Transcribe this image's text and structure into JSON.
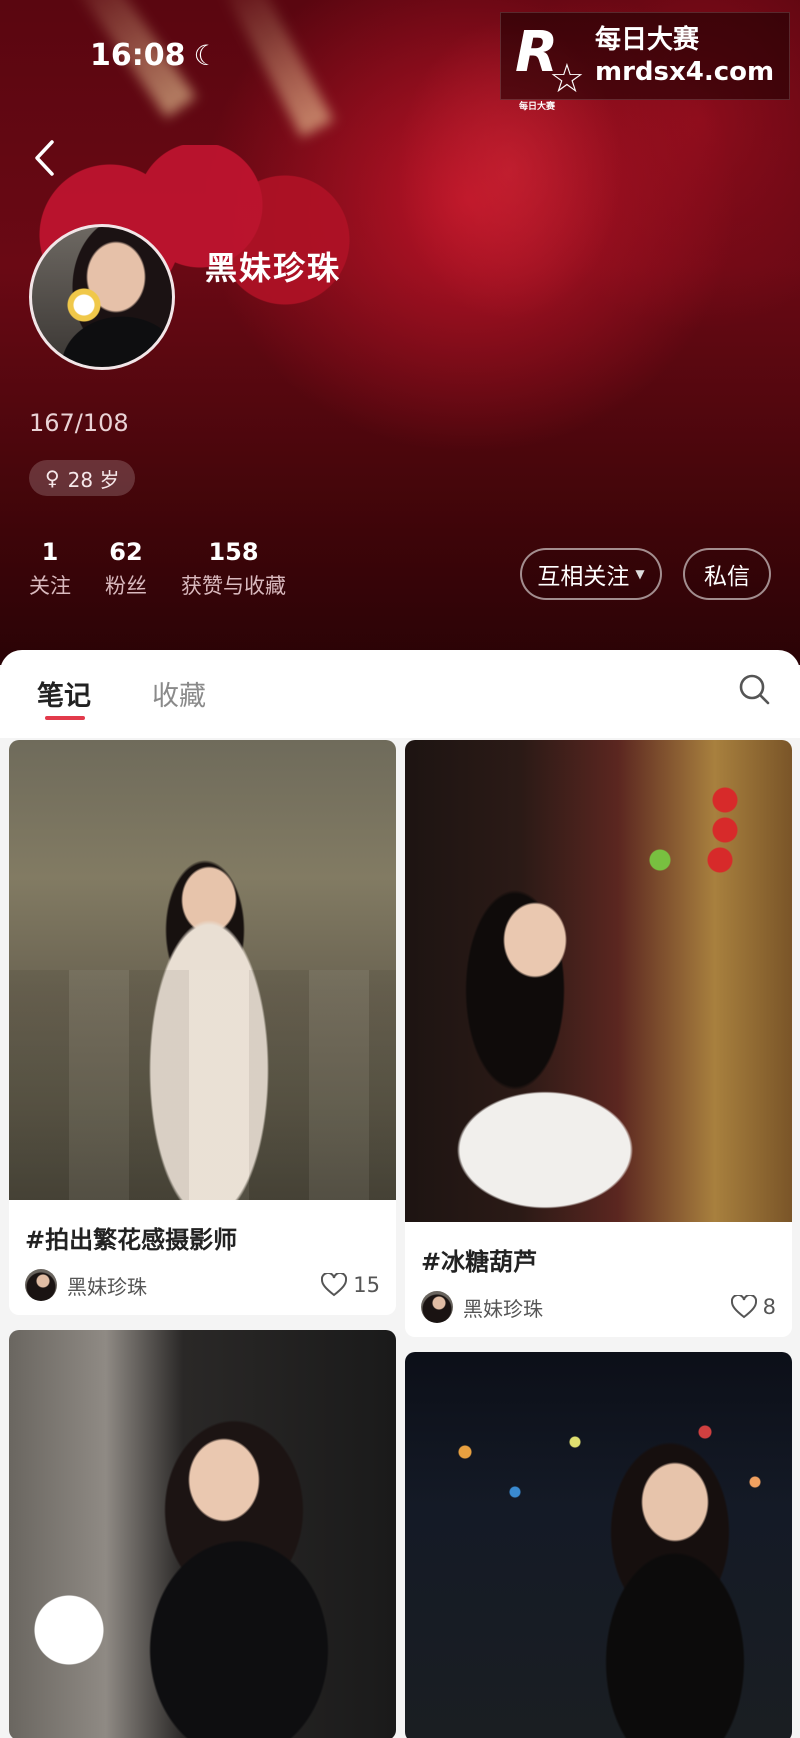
{
  "status_bar": {
    "time": "16:08",
    "moon_icon": "moon-icon"
  },
  "watermark": {
    "logo_letter": "R",
    "logo_small": "每日大赛",
    "line1": "每日大赛",
    "line2": "mrdsx4.com"
  },
  "profile": {
    "name": "黑妹珍珠",
    "height_weight": "167/108",
    "age": "28 岁",
    "gender_icon": "female-icon",
    "stats": [
      {
        "value": "1",
        "label": "关注"
      },
      {
        "value": "62",
        "label": "粉丝"
      },
      {
        "value": "158",
        "label": "获赞与收藏"
      }
    ],
    "follow_button": "互相关注",
    "message_button": "私信"
  },
  "tabs": {
    "notes": "笔记",
    "favorites": "收藏",
    "active": "笔记"
  },
  "colors": {
    "accent": "#e23a4b",
    "header_bg": "#5a0610"
  },
  "posts": [
    {
      "title": "#拍出繁花感摄影师",
      "author": "黑妹珍珠",
      "likes": "15"
    },
    {
      "title": "#冰糖葫芦",
      "author": "黑妹珍珠",
      "likes": "8"
    },
    {
      "title": "",
      "author": "",
      "likes": ""
    },
    {
      "title": "",
      "author": "",
      "likes": ""
    }
  ]
}
